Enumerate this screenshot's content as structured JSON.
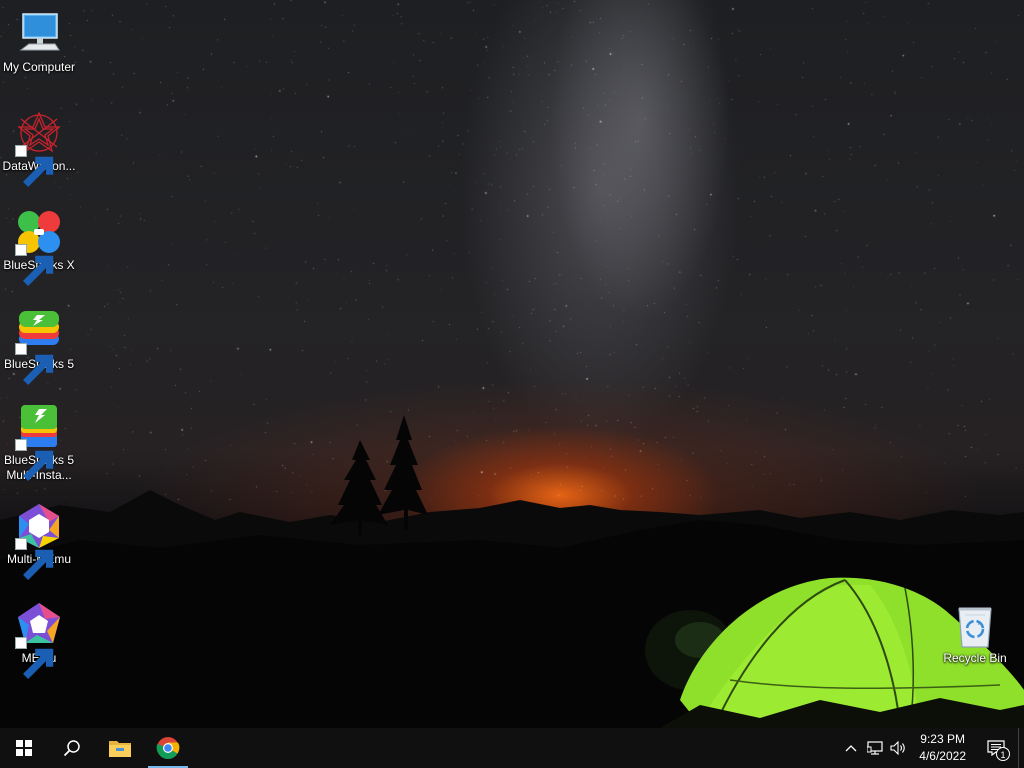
{
  "desktop": {
    "icons": [
      {
        "label": "My Computer",
        "icon": "computer-icon",
        "shortcut": false
      },
      {
        "label": "DataWagon...",
        "icon": "datawagon-icon",
        "shortcut": true
      },
      {
        "label": "BlueStacks X",
        "icon": "bluestacks-x-icon",
        "shortcut": true
      },
      {
        "label": "BlueStacks 5",
        "icon": "bluestacks-5-icon",
        "shortcut": true
      },
      {
        "label": "BlueStacks 5 Multi-Insta...",
        "icon": "bluestacks-multi-instance-icon",
        "shortcut": true
      },
      {
        "label": "Multi-MEmu",
        "icon": "multi-memu-icon",
        "shortcut": true
      },
      {
        "label": "MEmu",
        "icon": "memu-icon",
        "shortcut": true
      }
    ],
    "recycle_bin": {
      "label": "Recycle Bin",
      "icon": "recycle-bin-icon"
    }
  },
  "taskbar": {
    "items": [
      {
        "name": "start",
        "icon": "windows-logo-icon"
      },
      {
        "name": "search",
        "icon": "search-icon"
      },
      {
        "name": "file-explorer",
        "icon": "folder-icon"
      },
      {
        "name": "chrome",
        "icon": "chrome-icon",
        "active": true
      }
    ],
    "tray": {
      "icons": [
        "chevron-up-icon",
        "network-icon",
        "volume-icon"
      ],
      "time": "9:23 PM",
      "date": "4/6/2022",
      "notification_count": "1"
    }
  },
  "colors": {
    "taskbar_bg": "#101010",
    "accent": "#76b9ed",
    "tent_green": "#8ee02a",
    "horizon_glow": "#ff6e14"
  }
}
